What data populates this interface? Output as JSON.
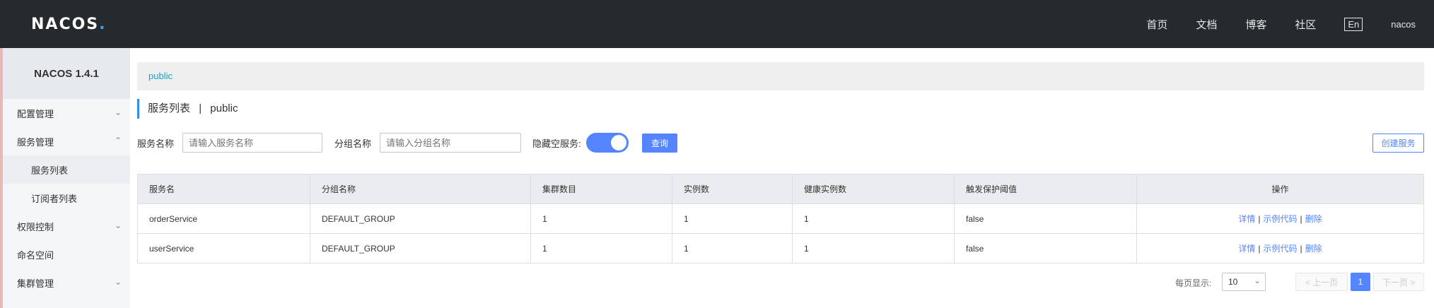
{
  "header": {
    "logo": "NACOS",
    "logo_dot": ".",
    "nav": [
      "首页",
      "文档",
      "博客",
      "社区"
    ],
    "lang": "En",
    "user": "nacos"
  },
  "sidebar": {
    "version": "NACOS 1.4.1",
    "items": [
      {
        "label": "配置管理",
        "chevron": "chevron-down"
      },
      {
        "label": "服务管理",
        "chevron": "chevron-up"
      },
      {
        "label": "服务列表"
      },
      {
        "label": "订阅者列表"
      },
      {
        "label": "权限控制",
        "chevron": "chevron-down"
      },
      {
        "label": "命名空间"
      },
      {
        "label": "集群管理",
        "chevron": "chevron-down"
      }
    ]
  },
  "breadcrumb": "public",
  "title": {
    "main": "服务列表",
    "sep": "|",
    "ns": "public"
  },
  "filters": {
    "service_label": "服务名称",
    "service_placeholder": "请输入服务名称",
    "group_label": "分组名称",
    "group_placeholder": "请输入分组名称",
    "hide_empty_label": "隐藏空服务:",
    "hide_empty_on": true,
    "query": "查询",
    "create": "创建服务"
  },
  "table": {
    "headers": [
      "服务名",
      "分组名称",
      "集群数目",
      "实例数",
      "健康实例数",
      "触发保护阈值",
      "操作"
    ],
    "rows": [
      [
        "orderService",
        "DEFAULT_GROUP",
        "1",
        "1",
        "1",
        "false"
      ],
      [
        "userService",
        "DEFAULT_GROUP",
        "1",
        "1",
        "1",
        "false"
      ]
    ],
    "ops": [
      "详情",
      "示例代码",
      "删除"
    ],
    "op_sep": "|"
  },
  "pagination": {
    "size_label": "每页显示:",
    "size": "10",
    "prev": "上一页",
    "current": "1",
    "next": "下一页"
  },
  "colors": {
    "accent": "#5584ff",
    "header": "#252a2f",
    "link": "#17a2c6"
  }
}
